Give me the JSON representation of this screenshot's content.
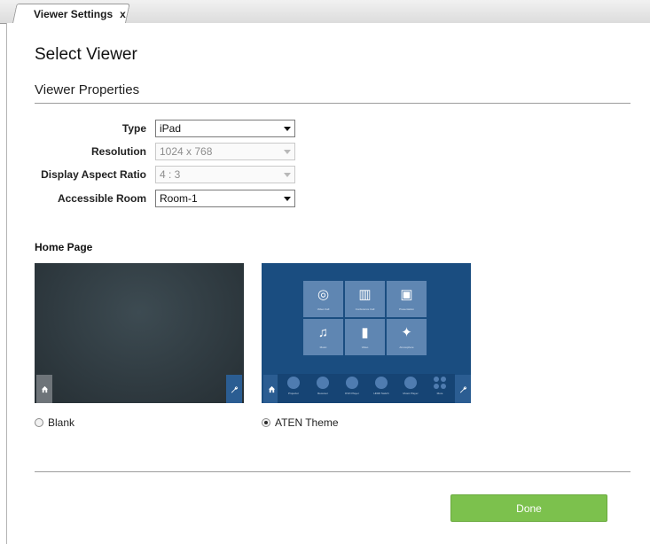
{
  "tab": {
    "label": "Viewer Settings",
    "close_glyph": "x"
  },
  "page": {
    "title": "Select Viewer",
    "section_title": "Viewer Properties"
  },
  "form": {
    "type": {
      "label": "Type",
      "value": "iPad"
    },
    "resolution": {
      "label": "Resolution",
      "value": "1024 x 768"
    },
    "aspect_ratio": {
      "label": "Display Aspect Ratio",
      "value": "4 : 3"
    },
    "room": {
      "label": "Accessible Room",
      "value": "Room-1"
    }
  },
  "home_page": {
    "title": "Home Page",
    "options": [
      {
        "label": "Blank",
        "selected": false
      },
      {
        "label": "ATEN Theme",
        "selected": true
      }
    ],
    "aten_tiles": [
      {
        "icon": "headset-icon",
        "glyph": "◎",
        "caption": "Video Call"
      },
      {
        "icon": "conference-icon",
        "glyph": "▥",
        "caption": "Conference Call"
      },
      {
        "icon": "presentation-icon",
        "glyph": "▣",
        "caption": "Presentation"
      },
      {
        "icon": "music-icon",
        "glyph": "♫",
        "caption": "Music"
      },
      {
        "icon": "video-icon",
        "glyph": "▮",
        "caption": "Video"
      },
      {
        "icon": "lightbulb-icon",
        "glyph": "✦",
        "caption": "Atmosphere"
      }
    ],
    "aten_dock": [
      "Projector",
      "Receiver",
      "DVD Player",
      "HDMI Switch",
      "Music Player",
      "More"
    ]
  },
  "footer": {
    "done_label": "Done"
  },
  "colors": {
    "done": "#7cc14d",
    "aten_bg": "#1a4d80",
    "tile": "#5f86b2"
  }
}
